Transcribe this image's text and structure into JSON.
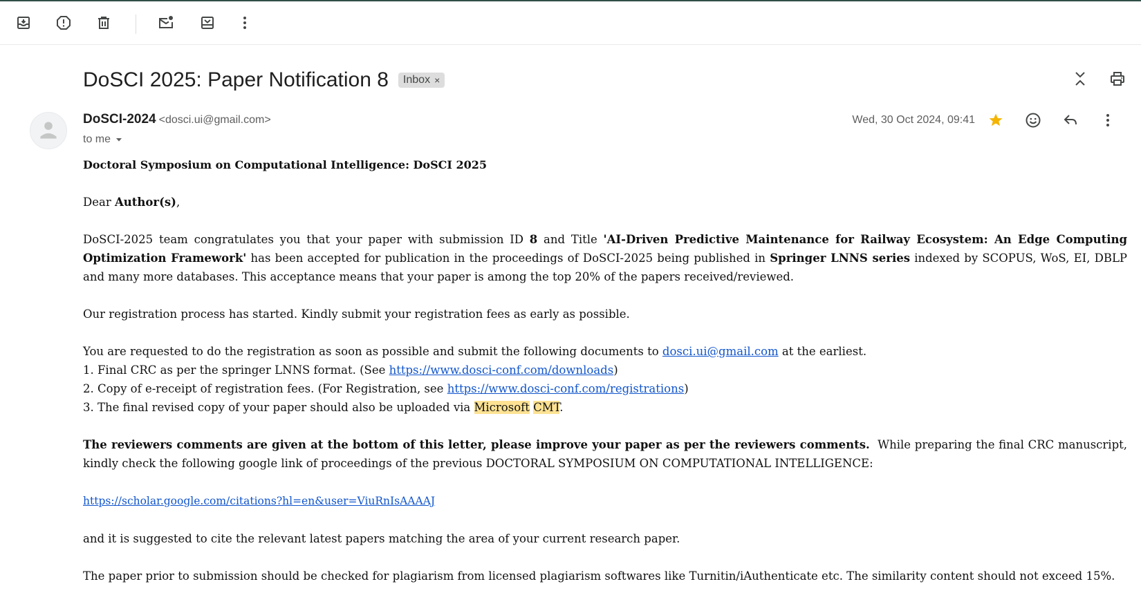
{
  "toolbar": {
    "icons": [
      "archive-icon",
      "report-spam-icon",
      "delete-icon",
      "mark-unread-icon",
      "move-to-icon",
      "more-vert-icon"
    ]
  },
  "header": {
    "subject": "DoSCI 2025: Paper Notification 8",
    "label": "Inbox",
    "label_close": "×"
  },
  "message": {
    "sender_name": "DoSCI-2024",
    "sender_email": "<dosci.ui@gmail.com>",
    "to": "to me",
    "date": "Wed, 30 Oct 2024, 09:41",
    "starred": true
  },
  "body": {
    "title": "Doctoral Symposium on Computational Intelligence: DoSCI 2025",
    "greeting_pre": "Dear ",
    "greeting_bold": "Author(s)",
    "greeting_post": ",",
    "p1_a": "DoSCI-2025 team congratulates you that your paper with submission ID ",
    "p1_id": "8",
    "p1_b": " and Title ",
    "p1_title": "'AI-Driven Predictive Maintenance for Railway Ecosystem: An Edge Computing Optimization Framework'",
    "p1_c": " has been accepted for publication in the proceedings of DoSCI-2025 being published in ",
    "p1_series": "Springer LNNS series",
    "p1_d": " indexed by SCOPUS, WoS, EI, DBLP and many more databases. This acceptance means that your paper is among the top 20% of the papers received/reviewed.",
    "p2": "Our registration process has started. Kindly submit your registration fees as early as possible.",
    "p3_a": "You are requested to do the registration as soon as possible and submit the following documents to ",
    "p3_email": "dosci.ui@gmail.com",
    "p3_b": " at the earliest.",
    "li1_a": "1. Final CRC as per the springer LNNS format. (See ",
    "li1_link": "https://www.dosci-conf.com/downloads",
    "li1_b": ")",
    "li2_a": "2. Copy of e-receipt of registration fees. (For Registration, see ",
    "li2_link": "https://www.dosci-conf.com/registrations",
    "li2_b": ")",
    "li3_a": "3. The final revised copy of your paper should also be uploaded via ",
    "li3_hl1": "Microsoft",
    "li3_hl2": "CMT",
    "li3_b": ".",
    "p4_bold": "The reviewers comments are given at the bottom of this letter, please improve your paper as per the reviewers comments.",
    "p4_rest": "  While preparing the final CRC manuscript, kindly check the following google link of proceedings of the previous DOCTORAL SYMPOSIUM ON COMPUTATIONAL INTELLIGENCE:",
    "scholar_link": "https://scholar.google.com/citations?hl=en&user=ViuRnIsAAAAJ",
    "p5": "and it is suggested to cite the relevant latest papers matching the area of your current research paper.",
    "p6": "The paper prior to submission should be checked for plagiarism from licensed plagiarism softwares like Turnitin/iAuthenticate etc. The similarity content should not exceed 15%."
  },
  "colors": {
    "link": "#1155cc",
    "star": "#f4b400",
    "highlight": "#fde293",
    "icon": "#444746"
  }
}
